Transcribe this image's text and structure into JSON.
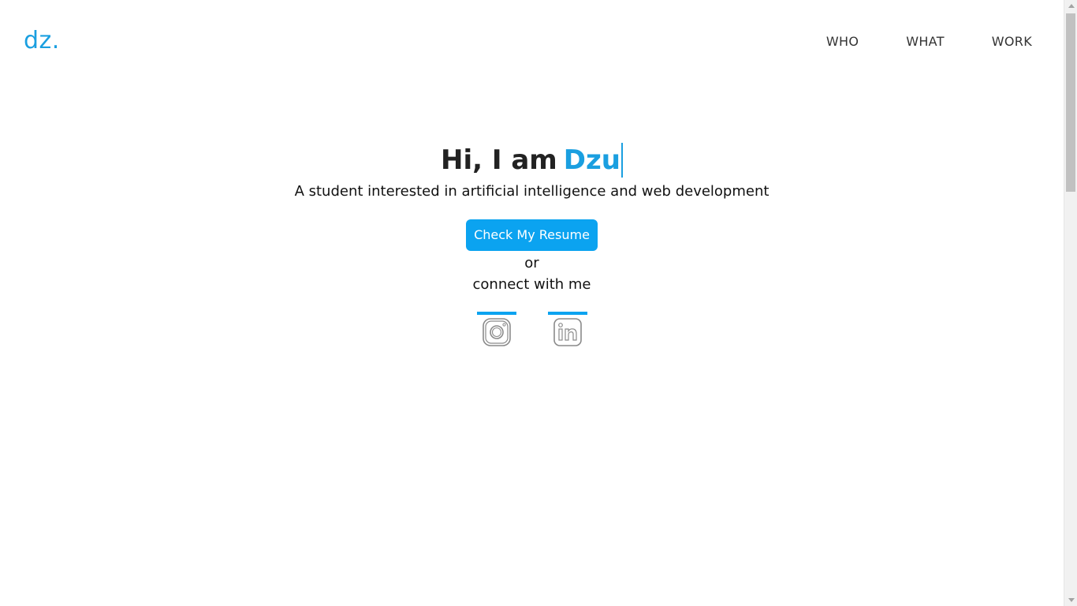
{
  "header": {
    "logo": "dz.",
    "nav": [
      "WHO",
      "WHAT",
      "WORK"
    ]
  },
  "hero": {
    "greeting": "Hi, I am",
    "name": "Dzu",
    "subtitle": "A student interested in artificial intelligence and web development",
    "resume_button": "Check My Resume",
    "or_text": "or",
    "connect_text": "connect with me"
  },
  "social": {
    "icons": [
      "instagram-icon",
      "linkedin-icon"
    ]
  },
  "colors": {
    "accent": "#1a9fe0",
    "button": "#0ba3f0",
    "text": "#222222"
  }
}
